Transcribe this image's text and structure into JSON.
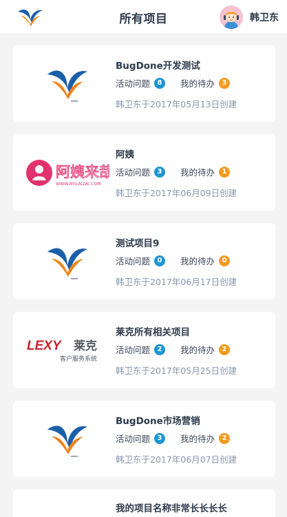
{
  "header": {
    "title": "所有项目",
    "user_name": "韩卫东",
    "logo_icon": "bugdone-logo-icon",
    "avatar_icon": "user-avatar-icon"
  },
  "labels": {
    "active_issues": "活动问题",
    "my_todo": "我的待办"
  },
  "colors": {
    "active_badge": "#1b96d2",
    "todo_badge": "#f39a1e",
    "brand_blue": "#1a5faa",
    "brand_orange": "#f0831e"
  },
  "projects": [
    {
      "name": "BugDone开发测试",
      "active": "8",
      "todo": "3",
      "created": "韩卫东于2017年05月13日创建",
      "logo": "bugdone"
    },
    {
      "name": "阿姨",
      "active": "3",
      "todo": "1",
      "created": "韩卫东于2017年06月09日创建",
      "logo": "ayi",
      "logo_text": "阿姨来哉",
      "logo_url_text": "WWW.AYILAIZAI.COM"
    },
    {
      "name": "测试项目9",
      "active": "0",
      "todo": "0",
      "created": "韩卫东于2017年06月17日创建",
      "logo": "bugdone"
    },
    {
      "name": "莱克所有相关项目",
      "active": "2",
      "todo": "2",
      "created": "韩卫东于2017年05月25日创建",
      "logo": "lexy",
      "logo_text": "LEXY",
      "logo_cn_text": "莱克",
      "logo_sub_text": "客户服务系统"
    },
    {
      "name": "BugDone市场营销",
      "active": "3",
      "todo": "2",
      "created": "韩卫东于2017年06月07日创建",
      "logo": "bugdone"
    },
    {
      "name": "我的项目名称非常长长长长"
    }
  ]
}
